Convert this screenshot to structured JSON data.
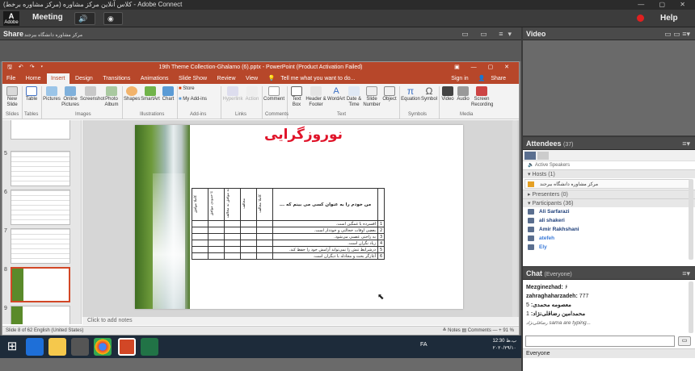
{
  "window": {
    "title": "کلاس آنلاین مرکز مشاوره (مرکز مشاوره برخط) - Adobe Connect",
    "controls": "— ▢ ✕"
  },
  "app": {
    "logo_text": "Adobe",
    "menu_meeting": "Meeting",
    "menu_help": "Help"
  },
  "share_pod": {
    "title": "Share",
    "subtitle": "مرکز مشاوره دانشگاه بیرجند"
  },
  "ppt": {
    "title": "19th Theme Collection-Ghalamo (6).pptx - PowerPoint (Product Activation Failed)",
    "tabs": [
      "File",
      "Home",
      "Insert",
      "Design",
      "Transitions",
      "Animations",
      "Slide Show",
      "Review",
      "View"
    ],
    "tell_me": "Tell me what you want to do...",
    "sign_in": "Sign in",
    "share": "Share",
    "ribbon": {
      "new_slide": "New Slide",
      "table": "Table",
      "pictures": "Pictures",
      "online_pictures": "Online Pictures",
      "screenshot": "Screenshot",
      "photo_album": "Photo Album",
      "shapes": "Shapes",
      "smartart": "SmartArt",
      "chart": "Chart",
      "store": "Store",
      "my_addins": "My Add-ins",
      "hyperlink": "Hyperlink",
      "action": "Action",
      "comment": "Comment",
      "text_box": "Text Box",
      "header_footer": "Header & Footer",
      "wordart": "WordArt",
      "date_time": "Date & Time",
      "slide_number": "Slide Number",
      "object": "Object",
      "equation": "Equation",
      "symbol": "Symbol",
      "video": "Video",
      "audio": "Audio",
      "screen_recording": "Screen Recording",
      "groups": [
        "Slides",
        "Tables",
        "Images",
        "Illustrations",
        "Add-ins",
        "Links",
        "Comments",
        "Text",
        "Symbols",
        "Media"
      ]
    },
    "thumb_numbers": [
      "5",
      "6",
      "7",
      "8",
      "9"
    ],
    "slide": {
      "title": "نوروزگرایی",
      "question_header": "من خودم را به عنوان کسی می بینم که ...",
      "col_headers": [
        "کاملا مخالف",
        "مخالف",
        "نه موافق نه مخالف",
        "تا حدودی موافق",
        "کاملا موافق"
      ],
      "rows": [
        {
          "n": "1",
          "text": "افسرده یا غمگین است."
        },
        {
          "n": "2",
          "text": "بعضی اوقات خجالتی و خوددار است."
        },
        {
          "n": "3",
          "text": "به راحتی عصبی می‌شود."
        },
        {
          "n": "4",
          "text": "زیاد نگران است."
        },
        {
          "n": "5",
          "text": "درشرایط تنش زا نمی‌تواند آرامش خود را حفظ کند."
        },
        {
          "n": "6",
          "text": "آغازگر بحث و مجادله با دیگران است."
        }
      ]
    },
    "notes_placeholder": "Click to add notes",
    "status_left": "Slide 8 of 62      English (United States)",
    "status_right": "≜ Notes   ▤ Comments        —  +  91 %",
    "zoom": "91 %"
  },
  "taskbar": {
    "lang": "FA",
    "time": "12:30 ب.ظ",
    "date": "۲۰۲۰/۲۹/۱۰"
  },
  "video_pod": {
    "title": "Video"
  },
  "attendees_pod": {
    "title": "Attendees",
    "count": "(37)",
    "active_speakers": "Active Speakers",
    "hosts_label": "Hosts (1)",
    "host_name": "مرکز مشاوره دانشگاه بیرجند",
    "presenters_label": "Presenters (0)",
    "participants_label": "Participants (36)",
    "participants": [
      "Ali Sarfarazi",
      "ali shakeri",
      "Amir Rakhshani",
      "atefeh",
      "Ely"
    ]
  },
  "chat_pod": {
    "title": "Chat",
    "scope": "(Everyone)",
    "messages": [
      {
        "who": "Mezginezhad:",
        "text": " ۶"
      },
      {
        "who": "zahraghaharzadeh:",
        "text": " 777"
      },
      {
        "who": "معصومه محمدی:",
        "text": " 5"
      },
      {
        "who": "محمدامین رضاقلی‌نژاد:",
        "text": " 1"
      }
    ],
    "typing": "sama are typing...",
    "typing_name": "رضاقلی‌نژاد",
    "recipient": "Everyone"
  },
  "colors": {
    "ppt_accent": "#b7472a",
    "slide_title": "#e0142a",
    "link_blue": "#1e3f7a"
  }
}
